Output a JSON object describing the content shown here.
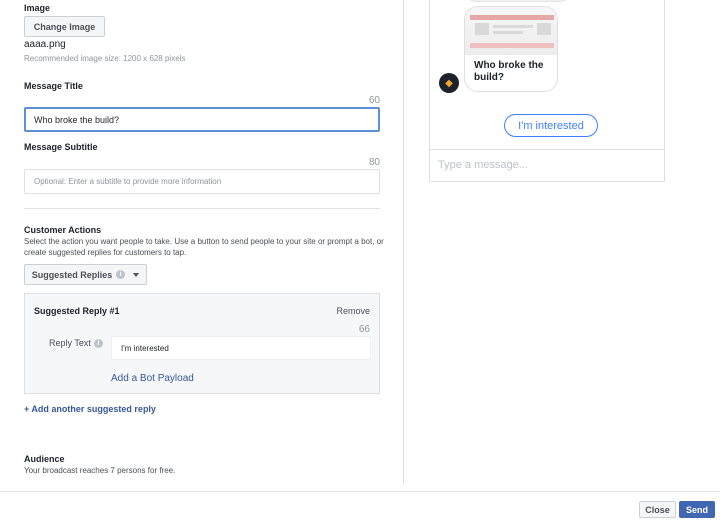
{
  "image_section": {
    "label": "Image",
    "change_button": "Change Image",
    "filename": "aaaa.png",
    "recommended": "Recommended image size: 1200 x 628 pixels"
  },
  "message_title": {
    "label": "Message Title",
    "char_limit": "60",
    "value": "Who broke the build?"
  },
  "message_subtitle": {
    "label": "Message Subtitle",
    "char_limit": "80",
    "placeholder": "Optional: Enter a subtitle to provide more information"
  },
  "customer_actions": {
    "label": "Customer Actions",
    "description": "Select the action you want people to take. Use a button to send people to your site or prompt a bot, or create suggested replies for customers to tap.",
    "dropdown_value": "Suggested Replies"
  },
  "suggested_reply": {
    "heading": "Suggested Reply #1",
    "remove_label": "Remove",
    "char_limit": "66",
    "reply_text_label": "Reply Text",
    "reply_text_value": "I'm interested",
    "bot_payload_link": "Add a Bot Payload"
  },
  "add_reply_link": "+ Add another suggested reply",
  "audience": {
    "label": "Audience",
    "description": "Your broadcast reaches 7 persons for free."
  },
  "preview": {
    "card_title": "Who broke the build?",
    "quick_reply": "I'm interested",
    "composer_placeholder": "Type a message..."
  },
  "footer": {
    "close_label": "Close",
    "send_label": "Send"
  },
  "colors": {
    "accent": "#4267b2",
    "link": "#365899",
    "messenger_blue": "#4080ff",
    "focus_border": "#5b90d2"
  },
  "icons": {
    "info": "info-icon",
    "dropdown": "caret-down-icon",
    "bot_avatar": "bot-avatar-icon"
  }
}
